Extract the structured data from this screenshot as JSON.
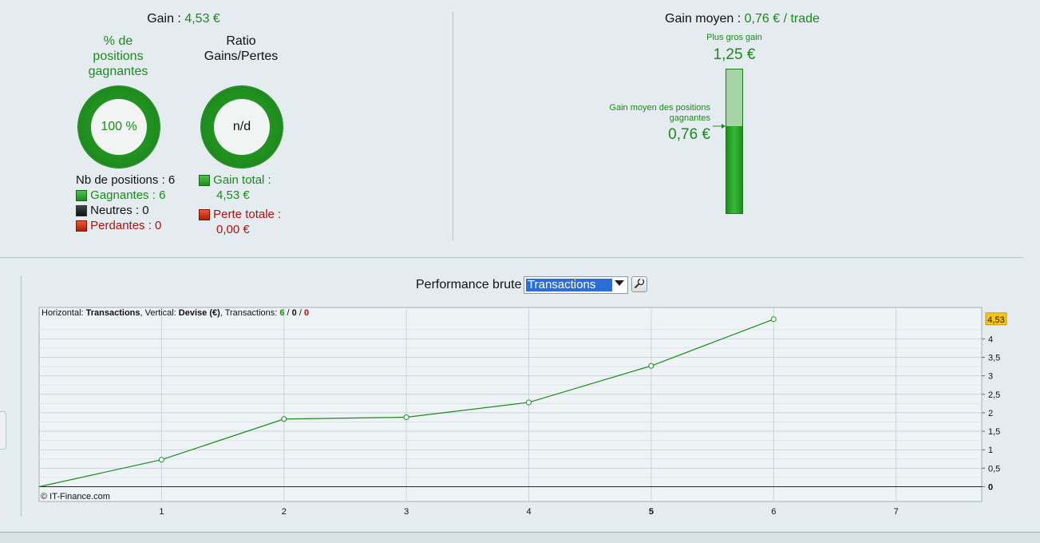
{
  "top_left": {
    "gain_label": "Gain : ",
    "gain_value": "4,53 €",
    "pct_title_lines": [
      "% de",
      "positions",
      "gagnantes"
    ],
    "pct_value": "100 %",
    "pct_fraction": 1.0,
    "ratio_title_lines": [
      "Ratio",
      "Gains/Pertes"
    ],
    "ratio_value": "n/d",
    "nb_positions": "Nb de positions : 6",
    "gagnantes": "Gagnantes : 6",
    "neutres": "Neutres : 0",
    "perdantes": "Perdantes : 0",
    "gain_total_label": "Gain total :",
    "gain_total_value": "4,53 €",
    "perte_totale_label": "Perte totale :",
    "perte_totale_value": "0,00 €"
  },
  "top_right": {
    "gain_moyen_label": "Gain moyen : ",
    "gain_moyen_value": "0,76 € / trade",
    "plus_gros_gain_label": "Plus gros gain",
    "plus_gros_gain_value": "1,25 €",
    "gain_moyen_pos_label_lines": [
      "Gain moyen des positions",
      "gagnantes"
    ],
    "gain_moyen_pos_value": "0,76 €",
    "bar_fill_fraction": 0.608
  },
  "performance": {
    "title": "Performance brute",
    "select_value": "Transactions",
    "info_prefix": "Horizontal: ",
    "info_h": "Transactions",
    "info_mid": ", Vertical: ",
    "info_v": "Devise (€)",
    "info_tx": ", Transactions: ",
    "info_win": "6",
    "info_sep1": " / ",
    "info_neutral": "0",
    "info_sep2": " / ",
    "info_loss": "0",
    "copyright": "© IT-Finance.com"
  },
  "colors": {
    "green": "#1a8a1a",
    "red": "#b01010",
    "line": "#1e8a1e",
    "zero_line": "#1a1a7a",
    "last_value_badge": "#f5c518"
  },
  "chart_data": {
    "type": "line",
    "x": [
      0,
      1,
      2,
      3,
      4,
      5,
      6
    ],
    "series": [
      {
        "values": [
          0,
          0.73,
          1.83,
          1.88,
          2.28,
          3.27,
          4.53
        ]
      }
    ],
    "xlim": [
      0,
      7.7
    ],
    "ylim": [
      -0.4,
      4.85
    ],
    "x_ticks": [
      "1",
      "2",
      "3",
      "4",
      "5",
      "6",
      "7"
    ],
    "y_ticks": [
      "0",
      "0,5",
      "1",
      "1,5",
      "2",
      "2,5",
      "3",
      "3,5",
      "4"
    ],
    "y_tick_values": [
      0,
      0.5,
      1,
      1.5,
      2,
      2.5,
      3,
      3.5,
      4
    ],
    "last_value_label": "4,53",
    "grid": true
  }
}
